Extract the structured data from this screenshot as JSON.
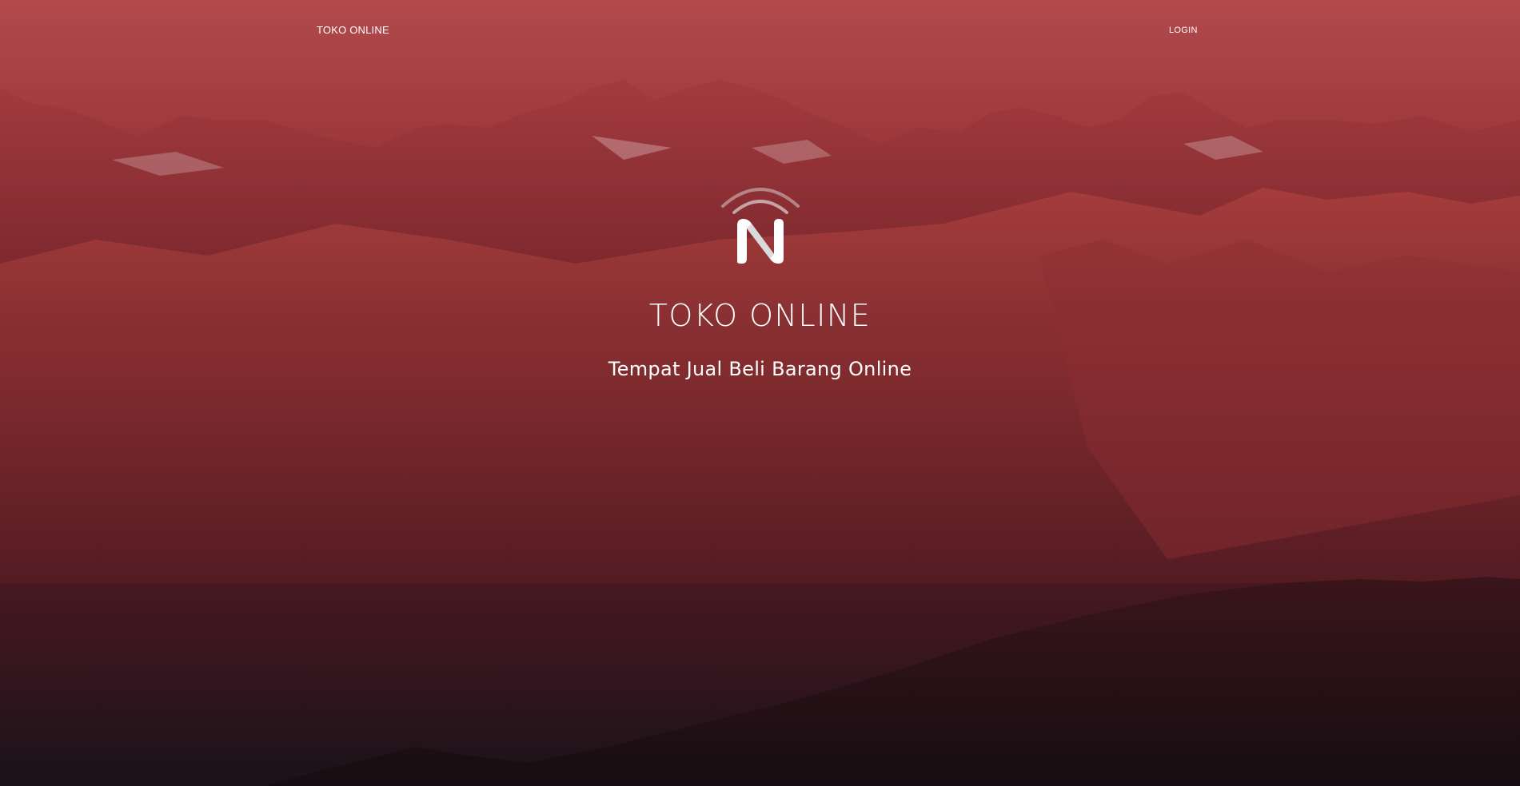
{
  "navbar": {
    "brand_label": "TOKO ONLINE",
    "login_label": "LOGIN"
  },
  "hero": {
    "logo_icon": "n-signal-logo-icon",
    "title": "TOKO ONLINE",
    "subtitle": "Tempat Jual Beli Barang Online"
  },
  "colors": {
    "sky_top": "#b24a4c",
    "mountain_red": "#9a363a",
    "deep_maroon": "#5c1c22",
    "bottom_dark": "#1a1218",
    "text": "#ffffff"
  }
}
